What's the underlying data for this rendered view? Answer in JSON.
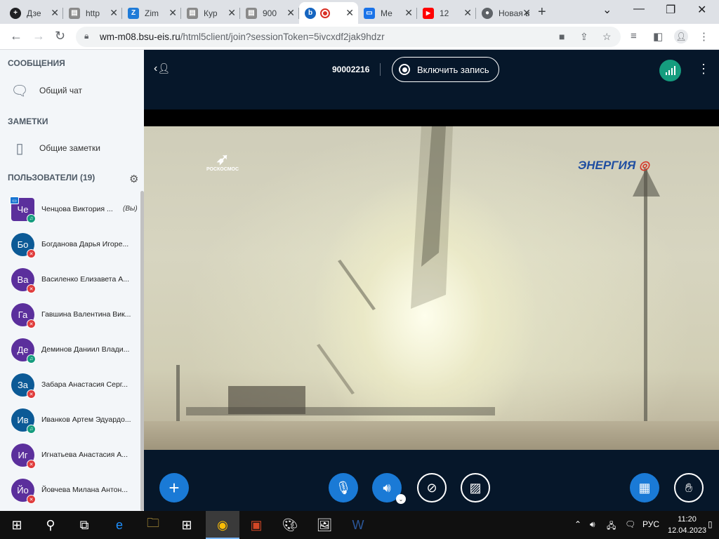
{
  "browser": {
    "tabs": [
      {
        "title": "Дзе",
        "favicon": "plus-icon",
        "color": "#202124"
      },
      {
        "title": "http",
        "favicon": "blank-page-icon",
        "color": "#8a8a8a"
      },
      {
        "title": "Zim",
        "favicon": "zimbra-icon",
        "color": "#1f7bd8"
      },
      {
        "title": "Кур",
        "favicon": "blank-page-icon",
        "color": "#8a8a8a"
      },
      {
        "title": "900",
        "favicon": "blank-page-icon",
        "color": "#8a8a8a"
      },
      {
        "title": "",
        "favicon": "bigbluebutton-icon",
        "color": "#1565c0",
        "active": true
      },
      {
        "title": "Ме",
        "favicon": "message-icon",
        "color": "#1a73e8"
      },
      {
        "title": "12",
        "favicon": "youtube-icon",
        "color": "#ff0000"
      },
      {
        "title": "Новая в",
        "favicon": "chrome-icon",
        "color": "#5f6368"
      }
    ],
    "url_host": "wm-m08.bsu-eis.ru",
    "url_path": "/html5client/join?sessionToken=5ivcxdf2jak9hdzr"
  },
  "sidebar": {
    "messages_title": "СООБЩЕНИЯ",
    "public_chat": "Общий чат",
    "notes_title": "ЗАМЕТКИ",
    "shared_notes": "Общие заметки",
    "users_title": "ПОЛЬЗОВАТЕЛИ (19)",
    "you_label": "(Вы)",
    "users": [
      {
        "initials": "Че",
        "name": "Ченцова Виктория ...",
        "color": "#5b2f9c",
        "status": "listen-only",
        "presenter": true,
        "you": true
      },
      {
        "initials": "Бо",
        "name": "Богданова Дарья Игоре...",
        "color": "#0c5a96",
        "status": "muted"
      },
      {
        "initials": "Ва",
        "name": "Василенко Елизавета А...",
        "color": "#5b2f9c",
        "status": "muted"
      },
      {
        "initials": "Га",
        "name": "Гавшина Валентина Вик...",
        "color": "#5b2f9c",
        "status": "muted"
      },
      {
        "initials": "Де",
        "name": "Деминов Даниил Влади...",
        "color": "#5b2f9c",
        "status": "listen-only"
      },
      {
        "initials": "За",
        "name": "Забара Анастасия Серг...",
        "color": "#0c5a96",
        "status": "muted"
      },
      {
        "initials": "Ив",
        "name": "Иванков Артем Эдуардо...",
        "color": "#0c5a96",
        "status": "listen-only"
      },
      {
        "initials": "Иг",
        "name": "Игнатьева Анастасия А...",
        "color": "#5b2f9c",
        "status": "muted"
      },
      {
        "initials": "Йо",
        "name": "Йовчева Милана Антон...",
        "color": "#5b2f9c",
        "status": "muted"
      }
    ]
  },
  "meeting": {
    "id": "90002216",
    "record_label": "Включить запись"
  },
  "video": {
    "logo_left": "РОСКОСМОС",
    "logo_right": "ЭНЕРГИЯ"
  },
  "taskbar": {
    "lang": "РУС",
    "time": "11:20",
    "date": "12.04.2023"
  }
}
